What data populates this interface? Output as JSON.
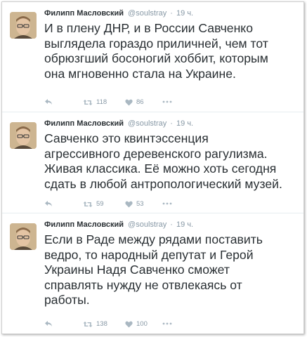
{
  "tweets": [
    {
      "name": "Филипп Масловский",
      "handle": "@soulstray",
      "separator": "·",
      "time": "19 ч.",
      "text": "И в плену ДНР, и в России Савченко\nвыглядела гораздо приличней, чем тот\nобрюзгший босоногий хоббит, которым\nона мгновенно стала на Украине.",
      "retweets": "118",
      "likes": "86"
    },
    {
      "name": "Филипп Масловский",
      "handle": "@soulstray",
      "separator": "·",
      "time": "19 ч.",
      "text": "Савченко это квинтэссенция\nагрессивного деревенского рагулизма.\nЖивая классика. Её можно хоть сегодня\nсдать в любой антропологический музей.",
      "retweets": "59",
      "likes": "53"
    },
    {
      "name": "Филипп Масловский",
      "handle": "@soulstray",
      "separator": "·",
      "time": "19 ч.",
      "text": "Если в Раде между рядами поставить\nведро, то народный депутат и Герой\nУкраины Надя Савченко сможет\nсправлять нужду не отвлекаясь от\nработы.",
      "retweets": "138",
      "likes": "100"
    }
  ],
  "icons": {
    "reply": "reply-icon",
    "retweet": "retweet-icon",
    "like": "heart-icon",
    "more": "more-dots-icon"
  },
  "colors": {
    "text": "#292f33",
    "meta": "#8899a6",
    "icon": "#aab8c2"
  }
}
